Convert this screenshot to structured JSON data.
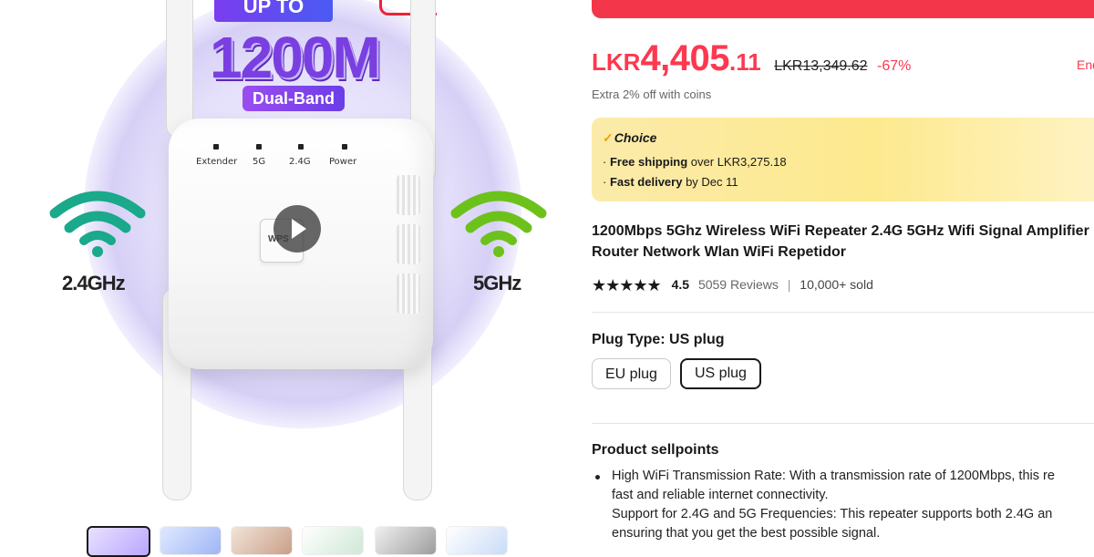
{
  "gallery": {
    "promo_top": "UP TO",
    "promo_big": "1200M",
    "promo_band": "Dual-Band",
    "led_labels": [
      "Extender",
      "5G",
      "2.4G",
      "Power"
    ],
    "wps_label": "WPS",
    "band_left": "2.4GHz",
    "band_right": "5GHz",
    "wifi_left_color": "#1aa98a",
    "wifi_right_color": "#6cc21b",
    "thumbnails": 6
  },
  "price": {
    "currency": "LKR",
    "integer": "4,405",
    "decimal": ".11",
    "original": "LKR13,349.62",
    "discount": "-67%",
    "ends_label": "End",
    "coins_note": "Extra 2% off with coins",
    "accent_color": "#fd384f"
  },
  "choice": {
    "badge": "Choice",
    "shipping_bold": "Free shipping",
    "shipping_rest": " over LKR3,275.18",
    "delivery_bold": "Fast delivery",
    "delivery_rest": " by Dec 11"
  },
  "product": {
    "title": "1200Mbps 5Ghz Wireless WiFi Repeater 2.4G 5GHz Wifi Signal Amplifier Router Network Wlan WiFi Repetidor",
    "stars": "★★★★★",
    "rating": "4.5",
    "reviews": "5059 Reviews",
    "separator": "|",
    "sold": "10,000+ sold"
  },
  "plug": {
    "label": "Plug Type:",
    "selected_value": "US plug",
    "options": [
      "EU plug",
      "US plug"
    ],
    "selected_index": 1
  },
  "sellpoints": {
    "heading": "Product sellpoints",
    "lines": [
      "High WiFi Transmission Rate: With a transmission rate of 1200Mbps, this re",
      "fast and reliable internet connectivity.",
      "Support for 2.4G and 5G Frequencies: This repeater supports both 2.4G an",
      "ensuring that you get the best possible signal."
    ]
  }
}
